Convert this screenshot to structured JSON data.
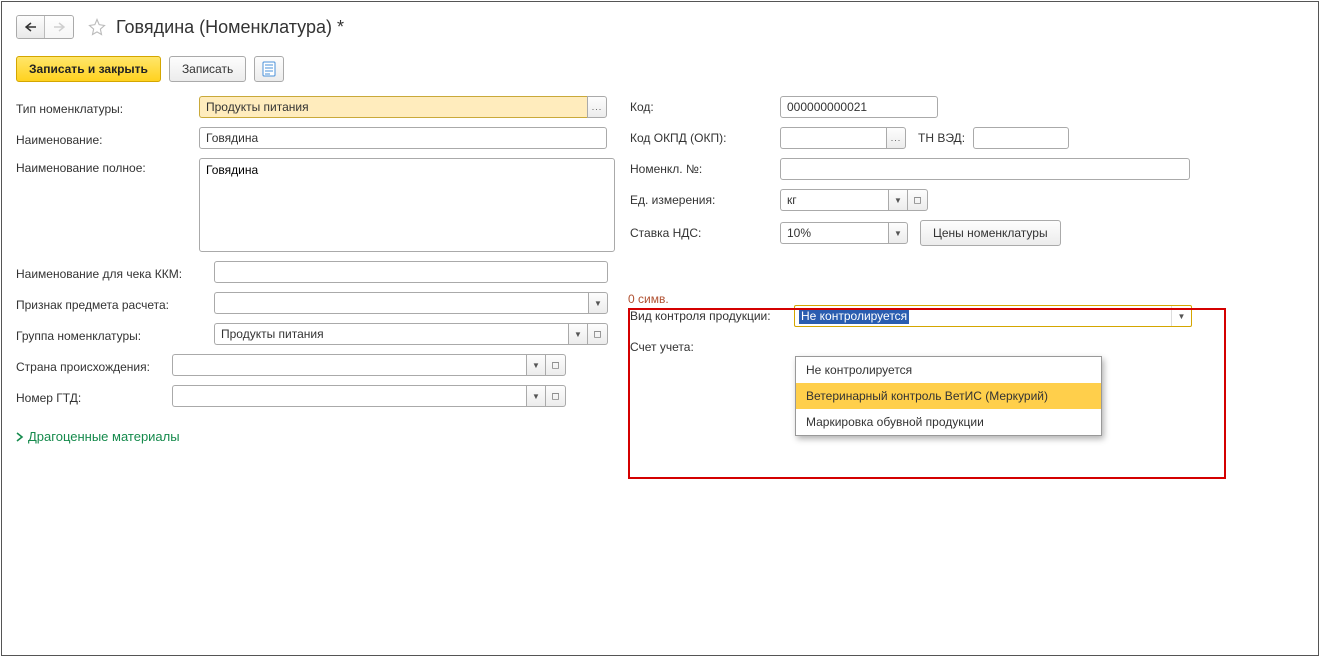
{
  "header": {
    "title": "Говядина (Номенклатура) *"
  },
  "toolbar": {
    "save_close": "Записать и закрыть",
    "save": "Записать"
  },
  "left": {
    "type_label": "Тип номенклатуры:",
    "type_value": "Продукты питания",
    "name_label": "Наименование:",
    "name_value": "Говядина",
    "fullname_label": "Наименование полное:",
    "fullname_value": "Говядина",
    "kkm_label": "Наименование для чека ККМ:",
    "kkm_value": "",
    "kkm_count": "0 симв.",
    "calc_subject_label": "Признак предмета расчета:",
    "calc_subject_value": "",
    "group_label": "Группа номенклатуры:",
    "group_value": "Продукты питания",
    "origin_label": "Страна происхождения:",
    "origin_value": "",
    "gtd_label": "Номер ГТД:",
    "gtd_value": "",
    "precious_link": "Драгоценные материалы"
  },
  "right": {
    "code_label": "Код:",
    "code_value": "000000000021",
    "okpd_label": "Код ОКПД (ОКП):",
    "okpd_value": "",
    "tnved_label": "ТН ВЭД:",
    "tnved_value": "",
    "nomno_label": "Номенкл. №:",
    "nomno_value": "",
    "unit_label": "Ед. измерения:",
    "unit_value": "кг",
    "vat_label": "Ставка НДС:",
    "vat_value": "10%",
    "prices_btn": "Цены номенклатуры",
    "control_label": "Вид контроля продукции:",
    "control_value": "Не контролируется",
    "control_options": [
      "Не контролируется",
      "Ветеринарный контроль ВетИС (Меркурий)",
      "Маркировка обувной продукции"
    ],
    "account_label": "Счет учета:"
  }
}
